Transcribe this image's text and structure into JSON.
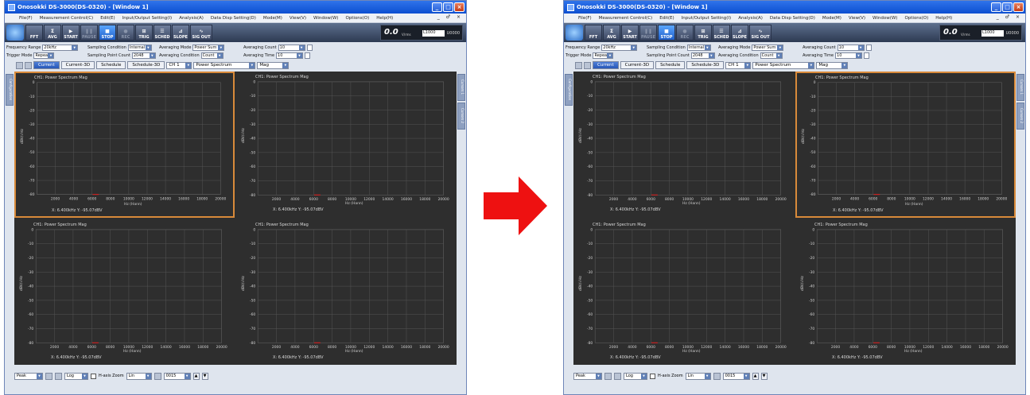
{
  "window": {
    "title": "Onosokki DS-3000(DS-0320) - [Window 1]",
    "controls": [
      "_",
      "□",
      "×"
    ],
    "mdi_controls": "_ ♂ ×"
  },
  "menu": [
    "File(F)",
    "Measurement Control(C)",
    "Edit(E)",
    "Input/Output Setting(I)",
    "Analysis(A)",
    "Data Disp Setting(D)",
    "Mode(M)",
    "View(V)",
    "Window(W)",
    "Options(O)",
    "Help(H)"
  ],
  "toolbar": {
    "buttons": [
      {
        "label": "FFT",
        "glyph": ""
      },
      {
        "label": "AVG",
        "glyph": "Σ"
      },
      {
        "label": "START",
        "glyph": "▶"
      },
      {
        "label": "PAUSE",
        "glyph": "❚❚"
      },
      {
        "label": "STOP",
        "glyph": "■"
      },
      {
        "label": "REC",
        "glyph": "●"
      },
      {
        "label": "TRIG",
        "glyph": "⊞"
      },
      {
        "label": "SCHED",
        "glyph": "☰"
      },
      {
        "label": "SLOPE",
        "glyph": "⊿"
      },
      {
        "label": "SIG OUT",
        "glyph": "∿"
      }
    ],
    "display": {
      "value": "0.0",
      "unit": "V/rms",
      "level": "L1000",
      "upper": "U0000"
    }
  },
  "conditions": {
    "frequency_range": {
      "label": "Frequency Range",
      "value": "20kHz"
    },
    "trigger_mode": {
      "label": "Trigger Mode",
      "value": "Repeat"
    },
    "sampling_condition": {
      "label": "Sampling Condition",
      "value": "Internal"
    },
    "sampling_point_count": {
      "label": "Sampling Point Count",
      "value": "2048"
    },
    "averaging_mode": {
      "label": "Averaging Mode",
      "value": "Power Sum"
    },
    "averaging_condition": {
      "label": "Averaging Condition",
      "value": "Count"
    },
    "averaging_count": {
      "label": "Averaging Count",
      "value": "10"
    },
    "averaging_time": {
      "label": "Averaging Time",
      "value": "10"
    }
  },
  "viewbar": {
    "tabs": [
      "Current",
      "Current-3D",
      "Schedule",
      "Schedule-3D"
    ],
    "channel": "CH 1",
    "function": "Power Spectrum",
    "mode": "Mag"
  },
  "side_tabs": {
    "left": "Configuration",
    "right": [
      "Cursors 1",
      "Cursors 2"
    ]
  },
  "graph": {
    "title": "CH1: Power Spectrum Mag",
    "xlabel": "Hz (Hann)",
    "ylabel": "dBV/√Hz",
    "cursor_readout": "X: 6.400kHz  Y: -95.07dBV",
    "y_ticks": [
      "0",
      "-10",
      "-20",
      "-30",
      "-40",
      "-50",
      "-60",
      "-70",
      "-80"
    ],
    "x_ticks": [
      "0",
      "2000",
      "4000",
      "6000",
      "8000",
      "10000",
      "12000",
      "14000",
      "16000",
      "18000",
      "20000"
    ],
    "cursor_x": 6400
  },
  "statusbar": {
    "peak": "Peak",
    "scale": "Log",
    "hzoom": "H-axis Zoom",
    "lin": "Lin",
    "frame": "0015"
  },
  "screens": [
    {
      "id": "before",
      "selected_panel": 0
    },
    {
      "id": "after",
      "selected_panel": 1
    }
  ],
  "colors": {
    "arrow": "#ee1111",
    "selection": "#d88a3a",
    "graph_bg": "#2e2e2e",
    "grid": "#555555",
    "cursor": "#cc2222",
    "active_button": "#1f5fc8"
  }
}
